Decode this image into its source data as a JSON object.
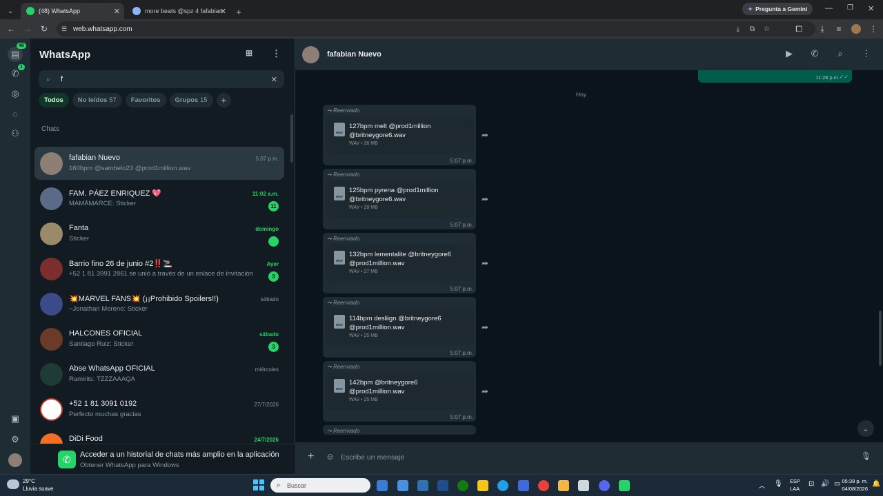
{
  "browser": {
    "tabs": [
      {
        "label": "(48) WhatsApp"
      },
      {
        "label": "more beats @spz 4 fafabian"
      }
    ],
    "new_tab": "+",
    "gemini": "Pregunta a Gemini",
    "url": "web.whatsapp.com"
  },
  "rail": {
    "chats_badge": "48",
    "calls_badge": "1"
  },
  "app": {
    "title": "WhatsApp",
    "search_value": "f",
    "filters": [
      {
        "label": "Todos",
        "count": ""
      },
      {
        "label": "No leídos",
        "count": "57"
      },
      {
        "label": "Favoritos",
        "count": ""
      },
      {
        "label": "Grupos",
        "count": "15"
      }
    ],
    "add_filter": "+",
    "chats_label": "Chats",
    "promo_title": "Acceder a un historial de chats más amplio en la aplicación",
    "promo_sub": "Obtener WhatsApp para Windows"
  },
  "chats": [
    {
      "name": "fafabian Nuevo",
      "preview": "160bpm @sambelo23 @prod1million.wav",
      "time": "5:07 p.m.",
      "badge": "",
      "green": false,
      "color": "#8d7f76"
    },
    {
      "name": "FAM. PÁEZ ENRIQUEZ 💖",
      "preview": "MAMÁMARCE: Sticker",
      "time": "11:02 a.m.",
      "badge": "11",
      "green": true,
      "color": "#5b6a86"
    },
    {
      "name": "Fanta",
      "preview": "Sticker",
      "time": "domingo",
      "badge": " ",
      "green": true,
      "color": "#9b8a6a"
    },
    {
      "name": "Barrio fino 26 de junio #2‼️🚬",
      "preview": "+52 1 81 3991 2861 se unió a través de un enlace de invitación",
      "time": "Ayer",
      "badge": "3",
      "green": true,
      "color": "#7a2e2e"
    },
    {
      "name": "💥MARVEL FANS💥 (¡¡Prohibido Spoilers!!)",
      "preview": "~Jonathan Moreno: Sticker",
      "time": "sábado",
      "badge": "",
      "green": false,
      "color": "#3c4a8a"
    },
    {
      "name": "HALCONES OFICIAL",
      "preview": "Santiago Ruiz: Sticker",
      "time": "sábado",
      "badge": "3",
      "green": true,
      "color": "#6b3b2a"
    },
    {
      "name": "Abse WhatsApp OFICIAL",
      "preview": "Ramirits: TZZZAAAQA",
      "time": "miércoles",
      "badge": "",
      "green": false,
      "color": "#1f3b35"
    },
    {
      "name": "+52 1 81 3091 0192",
      "preview": "Perfecto muchas gracias",
      "time": "27/7/2026",
      "badge": "",
      "green": false,
      "color": "#ffffff"
    },
    {
      "name": "DiDi Food",
      "preview": "",
      "time": "24/7/2026",
      "badge": "",
      "green": true,
      "color": "#f36f21"
    }
  ],
  "conversation": {
    "contact": "fafabian Nuevo",
    "prev_time": "11:28 p.m.",
    "day": "Hoy",
    "forward_label": "Reenviado",
    "messages": [
      {
        "file": "127bpm melt @prod1million @britneygore6.wav",
        "meta": "WAV • 28 MB",
        "time": "5:07 p.m."
      },
      {
        "file": "125bpm pyrena @prod1million @britneygore6.wav",
        "meta": "WAV • 28 MB",
        "time": "5:07 p.m."
      },
      {
        "file": "132bpm lementalite @britneygore6 @prod1million.wav",
        "meta": "WAV • 27 MB",
        "time": "5:07 p.m."
      },
      {
        "file": "114bpm desliign @britneygore6 @prod1million.wav",
        "meta": "WAV • 25 MB",
        "time": "5:07 p.m."
      },
      {
        "file": "142bpm @britneygore6 @prod1million.wav",
        "meta": "WAV • 25 MB",
        "time": "5:07 p.m."
      }
    ],
    "composer_placeholder": "Escribe un mensaje"
  },
  "taskbar": {
    "weather_temp": "29°C",
    "weather_desc": "Lluvia suave",
    "search": "Buscar",
    "lang": "ESP",
    "lang2": "LAA",
    "time": "05:38 p. m.",
    "date": "04/08/2026"
  }
}
